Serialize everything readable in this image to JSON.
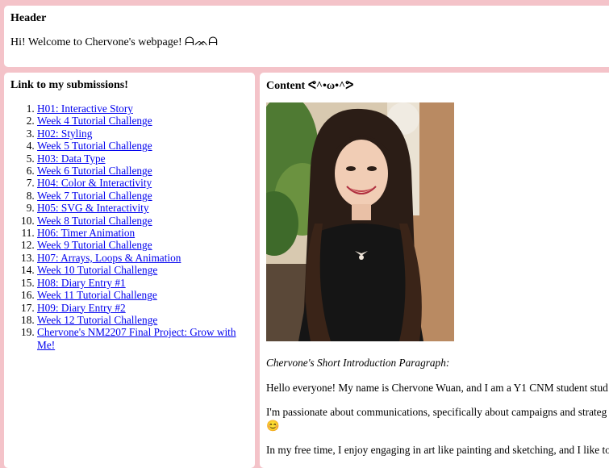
{
  "header": {
    "title": "Header",
    "welcome": "Hi! Welcome to Chervone's webpage! ᗩᨏᗩ"
  },
  "sidebar": {
    "title": "Link to my submissions!",
    "links": [
      "H01: Interactive Story",
      "Week 4 Tutorial Challenge",
      "H02: Styling",
      "Week 5 Tutorial Challenge",
      "H03: Data Type",
      "Week 6 Tutorial Challenge",
      "H04: Color & Interactivity",
      "Week 7 Tutorial Challenge",
      "H05: SVG & Interactivity",
      "Week 8 Tutorial Challenge",
      "H06: Timer Animation",
      "Week 9 Tutorial Challenge",
      "H07: Arrays, Loops & Animation",
      "Week 10 Tutorial Challenge",
      "H08: Diary Entry #1",
      "Week 11 Tutorial Challenge",
      "H09: Diary Entry #2",
      "Week 12 Tutorial Challenge",
      "Chervone's NM2207 Final Project: Grow with Me!"
    ]
  },
  "content": {
    "title": "Content ᕙ^•ω•^ᕗ",
    "intro_title": "Chervone's Short Introduction Paragraph:",
    "para1": "Hello everyone! My name is Chervone Wuan, and I am a Y1 CNM student stud",
    "para2": "I'm passionate about communications, specifically about campaigns and strateg",
    "para2_emoji": "😊",
    "para3": "In my free time, I enjoy engaging in art like painting and sketching, and I like to"
  },
  "colors": {
    "background": "#f4c3c9",
    "panel": "#ffffff",
    "link": "#0000ee"
  }
}
